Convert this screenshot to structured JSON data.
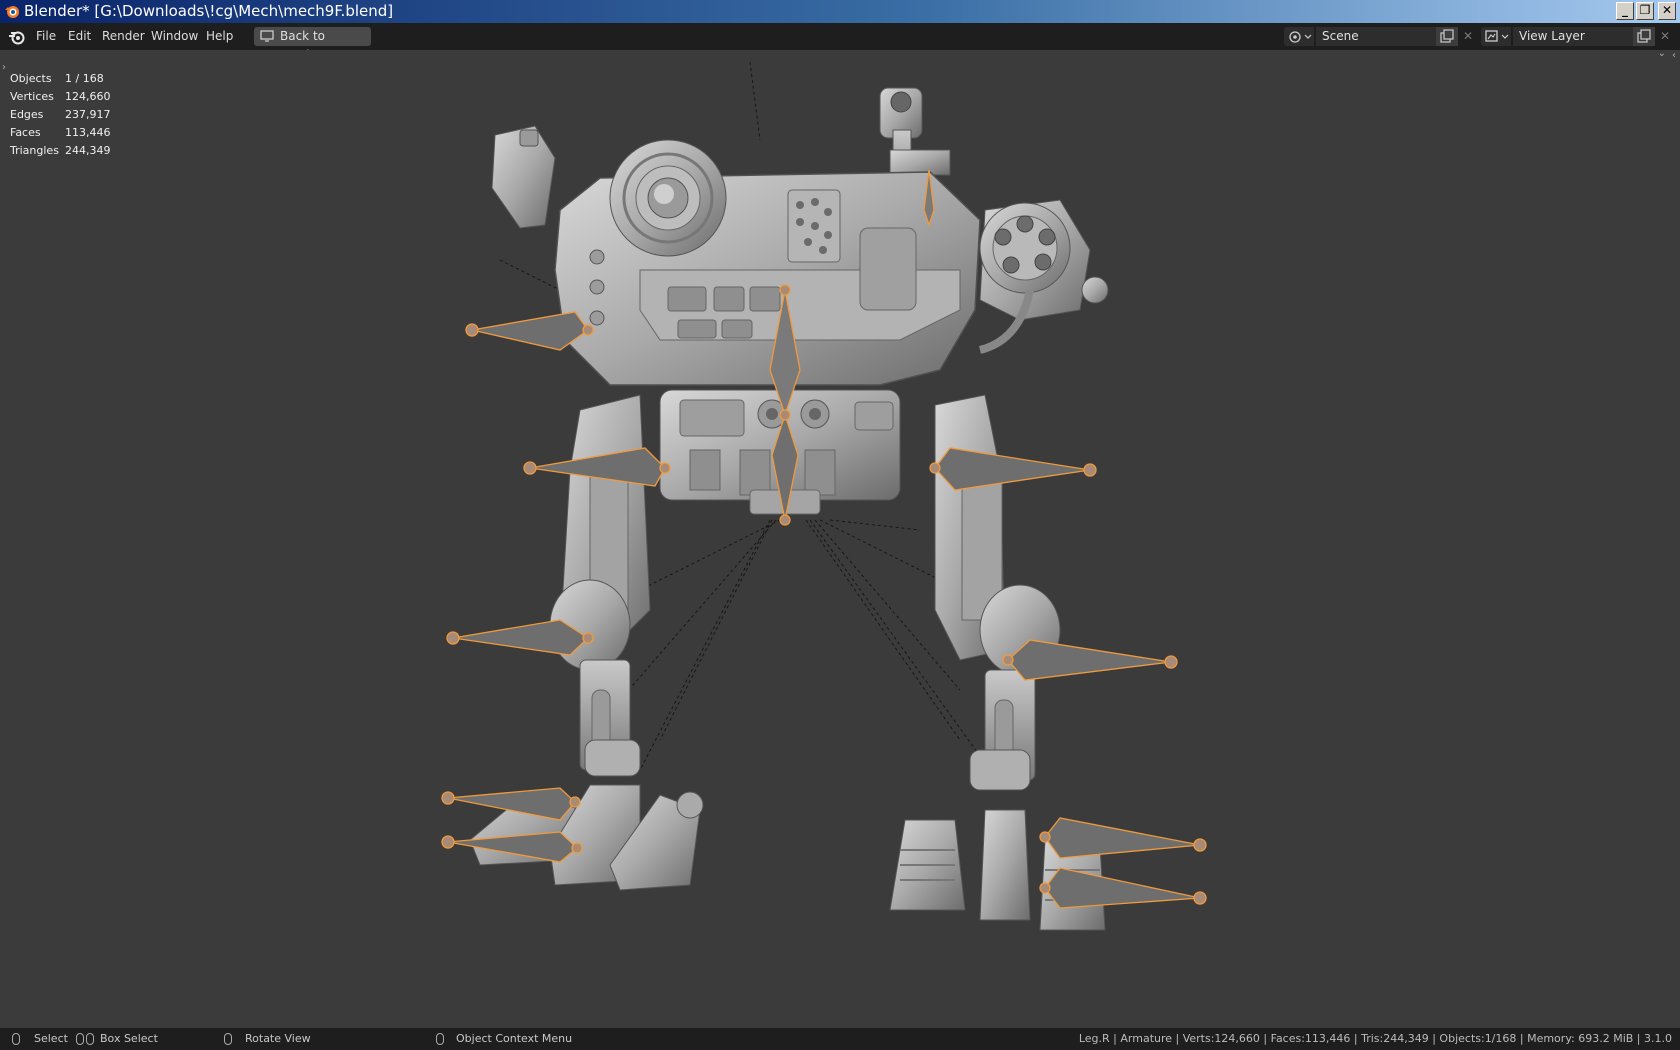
{
  "window": {
    "title": "Blender* [G:\\Downloads\\!cg\\Mech\\mech9F.blend]",
    "minimize_glyph": "_",
    "maximize_glyph": "❐",
    "close_glyph": "✕"
  },
  "menubar": {
    "items": [
      "File",
      "Edit",
      "Render",
      "Window",
      "Help"
    ],
    "back_button": "Back to Previous"
  },
  "scene_selector": {
    "label": "Scene"
  },
  "view_layer_selector": {
    "label": "View Layer"
  },
  "stats": [
    {
      "label": "Objects",
      "value": "1 / 168"
    },
    {
      "label": "Vertices",
      "value": "124,660"
    },
    {
      "label": "Edges",
      "value": "237,917"
    },
    {
      "label": "Faces",
      "value": "113,446"
    },
    {
      "label": "Triangles",
      "value": "244,349"
    }
  ],
  "statusbar": {
    "select": "Select",
    "box_select": "Box Select",
    "rotate_view": "Rotate View",
    "context_menu": "Object Context Menu",
    "info": "Leg.R | Armature | Verts:124,660 | Faces:113,446 | Tris:244,349 | Objects:1/168 | Memory: 693.2 MiB | 3.1.0"
  },
  "colors": {
    "bone_outline": "#ef9a3c",
    "viewport_bg": "#3b3b3b",
    "header_bg": "#1e1e1e"
  },
  "icons": [
    "blender-logo-icon",
    "monitor-icon",
    "scene-icon",
    "view-layer-icon",
    "copy-icon",
    "close-icon",
    "mouse-icon"
  ]
}
